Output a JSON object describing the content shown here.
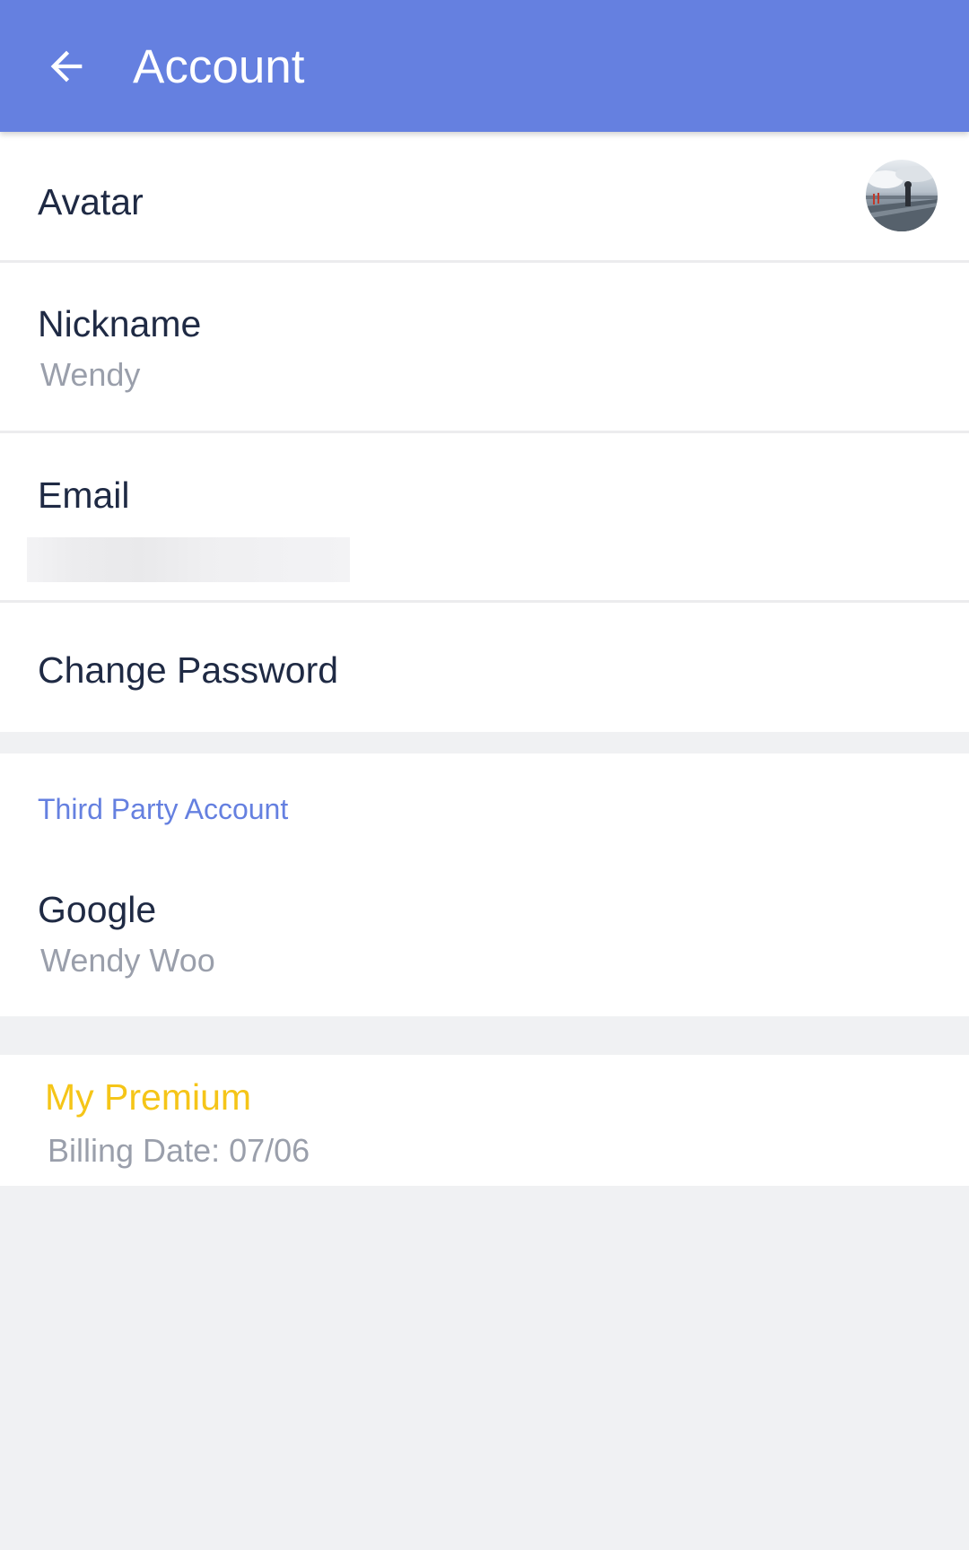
{
  "appbar": {
    "title": "Account",
    "back_icon": "arrow-back-icon",
    "color": "#6580e0"
  },
  "rows": {
    "avatar": {
      "label": "Avatar"
    },
    "nickname": {
      "label": "Nickname",
      "value": "Wendy"
    },
    "email": {
      "label": "Email",
      "value": ""
    },
    "change_password": {
      "label": "Change Password"
    }
  },
  "third_party": {
    "section_title": "Third Party Account",
    "google": {
      "label": "Google",
      "value": "Wendy Woo"
    }
  },
  "premium": {
    "title": "My Premium",
    "billing": "Billing Date: 07/06",
    "color": "#f5c518"
  }
}
